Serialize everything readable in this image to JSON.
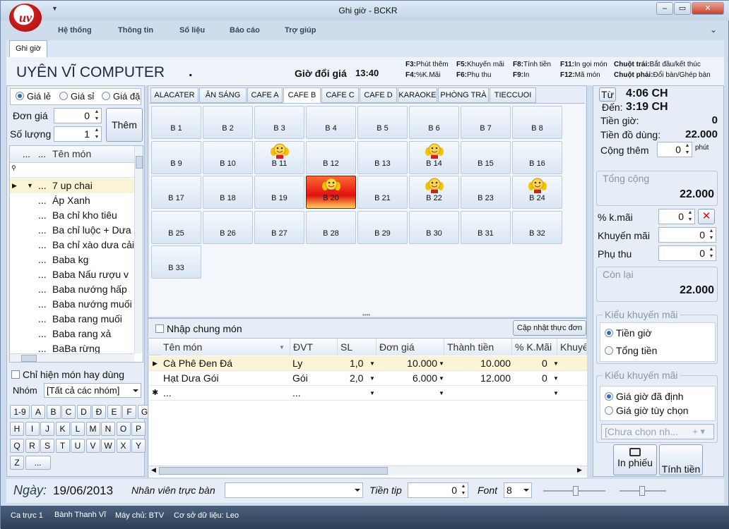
{
  "window": {
    "title": "Ghi giờ - BCKR",
    "logo_text": "uv"
  },
  "menu": [
    "Hệ thống",
    "Thông tin",
    "Số liệu",
    "Báo cáo",
    "Trợ giúp"
  ],
  "doc_tab": "Ghi giờ",
  "header": {
    "company": "UYÊN VĨ COMPUTER",
    "dot": ".",
    "price_change_label": "Giờ đổi giá",
    "price_change_time": "13:40"
  },
  "shortcuts": [
    {
      "key": "F3:",
      "text": "Phút thêm"
    },
    {
      "key": "F5:",
      "text": "Khuyến mãi"
    },
    {
      "key": "F8:",
      "text": "Tính tiền"
    },
    {
      "key": "F11:",
      "text": "In gọi món"
    },
    {
      "key": "Chuột trái:",
      "text": "Bắt đầu/kết thúc"
    },
    {
      "key": "F4:",
      "text": "%K.Mãi"
    },
    {
      "key": "F6:",
      "text": "Phụ thu"
    },
    {
      "key": "F9:",
      "text": "In"
    },
    {
      "key": "F12:",
      "text": "Mã món"
    },
    {
      "key": "Chuột phải:",
      "text": "Đổi bàn/Ghép bàn"
    }
  ],
  "left": {
    "price_options": [
      "Giá lẻ",
      "Giá sỉ",
      "Giá đặ"
    ],
    "selected_price": 0,
    "unit_price_label": "Đơn giá",
    "unit_price_value": "0",
    "qty_label": "Số lượng",
    "qty_value": "1",
    "add_button": "Thêm",
    "list_header": "Tên món",
    "header_dots1": "...",
    "header_dots2": "...",
    "items": [
      "7 up chai",
      "Áp Xanh",
      "Ba chỉ kho tiêu",
      "Ba chỉ luộc + Dưa",
      "Ba chỉ xào dưa cải",
      "Baba kg",
      "Baba Nấu rượu v",
      "Baba nướng hấp",
      "Baba nướng muối",
      "Baba rang muối",
      "Baba rang xả",
      "BaBa rừng"
    ],
    "item_dots": "...",
    "favorites_label": "Chỉ hiện món hay dùng",
    "group_label": "Nhóm",
    "group_value": "[Tất cả các nhóm]",
    "keys": [
      "1-9",
      "A",
      "B",
      "C",
      "D",
      "Đ",
      "E",
      "F",
      "G",
      "H",
      "I",
      "J",
      "K",
      "L",
      "M",
      "N",
      "O",
      "P",
      "Q",
      "R",
      "S",
      "T",
      "U",
      "V",
      "W",
      "X",
      "Y",
      "Z",
      "..."
    ]
  },
  "categories": [
    "ALACATER",
    "ĂN SÁNG",
    "CAFE A",
    "CAFE B",
    "CAFE C",
    "CAFE D",
    "KARAOKE",
    "PHÒNG TRÀ",
    "TIECCUOI"
  ],
  "active_category": "CAFE B",
  "tables": [
    {
      "name": "B 1",
      "busy": false
    },
    {
      "name": "B 2",
      "busy": false
    },
    {
      "name": "B 3",
      "busy": false
    },
    {
      "name": "B 4",
      "busy": false
    },
    {
      "name": "B 5",
      "busy": false
    },
    {
      "name": "B 6",
      "busy": false
    },
    {
      "name": "B 7",
      "busy": false
    },
    {
      "name": "B 8",
      "busy": false
    },
    {
      "name": "B 9",
      "busy": false
    },
    {
      "name": "B 10",
      "busy": false
    },
    {
      "name": "B 11",
      "busy": true
    },
    {
      "name": "B 12",
      "busy": false
    },
    {
      "name": "B 13",
      "busy": false
    },
    {
      "name": "B 14",
      "busy": true
    },
    {
      "name": "B 15",
      "busy": false
    },
    {
      "name": "B 16",
      "busy": false
    },
    {
      "name": "B 17",
      "busy": false
    },
    {
      "name": "B 18",
      "busy": false
    },
    {
      "name": "B 19",
      "busy": false
    },
    {
      "name": "B 20",
      "busy": true,
      "selected": true
    },
    {
      "name": "B 21",
      "busy": false
    },
    {
      "name": "B 22",
      "busy": true
    },
    {
      "name": "B 23",
      "busy": false
    },
    {
      "name": "B 24",
      "busy": true
    },
    {
      "name": "B 25",
      "busy": false
    },
    {
      "name": "B 26",
      "busy": false
    },
    {
      "name": "B 27",
      "busy": false
    },
    {
      "name": "B 28",
      "busy": false
    },
    {
      "name": "B 29",
      "busy": false
    },
    {
      "name": "B 30",
      "busy": false
    },
    {
      "name": "B 31",
      "busy": false
    },
    {
      "name": "B 32",
      "busy": false
    },
    {
      "name": "B 33",
      "busy": false
    }
  ],
  "order": {
    "common_label": "Nhập chung món",
    "update_button": "Cập nhật thực đơn",
    "columns": [
      "Tên món",
      "ĐVT",
      "SL",
      "Đơn giá",
      "Thành tiền",
      "% K.Mãi",
      "Khuyế"
    ],
    "rows": [
      {
        "name": "Cà Phê Đen Đá",
        "unit": "Ly",
        "qty": "1,0",
        "price": "10.000",
        "total": "10.000",
        "disc": "0"
      },
      {
        "name": "Hạt Dưa Gói",
        "unit": "Gói",
        "qty": "2,0",
        "price": "6.000",
        "total": "12.000",
        "disc": "0"
      }
    ],
    "new_row": "...",
    "new_row_unit": "..."
  },
  "right": {
    "from_button": "Từ",
    "from_time": "4:06 CH",
    "to_label": "Đến:",
    "to_time": "3:19 CH",
    "hours_label": "Tiền giờ:",
    "hours_value": "0",
    "items_label": "Tiền đồ dùng:",
    "items_value": "22.000",
    "extra_label": "Cộng thêm",
    "extra_value": "0",
    "extra_unit": "phút",
    "total_label": "Tổng cộng",
    "total_value": "22.000",
    "disc_pct_label": "% k.mãi",
    "disc_pct_value": "0",
    "promo_label": "Khuyến mãi",
    "promo_value": "0",
    "surcharge_label": "Phụ thu",
    "surcharge_value": "0",
    "remain_label": "Còn lại",
    "remain_value": "22.000",
    "promo_type_label": "Kiểu khuyến mãi",
    "promo_types": [
      "Tiền giờ",
      "Tổng tiền"
    ],
    "price_type_label": "Kiểu khuyến mãi",
    "price_types": [
      "Giá giờ đã định",
      "Giá giờ tùy chọn"
    ],
    "choose_placeholder": "[Chưa chọn nh...",
    "print_button": "In phiếu",
    "pay_button": "Tính tiền"
  },
  "bottom": {
    "date_label": "Ngày:",
    "date_value": "19/06/2013",
    "staff_label": "Nhân viên trực bàn",
    "staff_value": "",
    "tip_label": "Tiền tip",
    "tip_value": "0",
    "font_label": "Font",
    "font_value": "8"
  },
  "status": [
    "Ca trực 1",
    "Bành Thanh Vĩ",
    "Máy chủ: BTV",
    "Cơ sở dữ liệu: Leo"
  ]
}
